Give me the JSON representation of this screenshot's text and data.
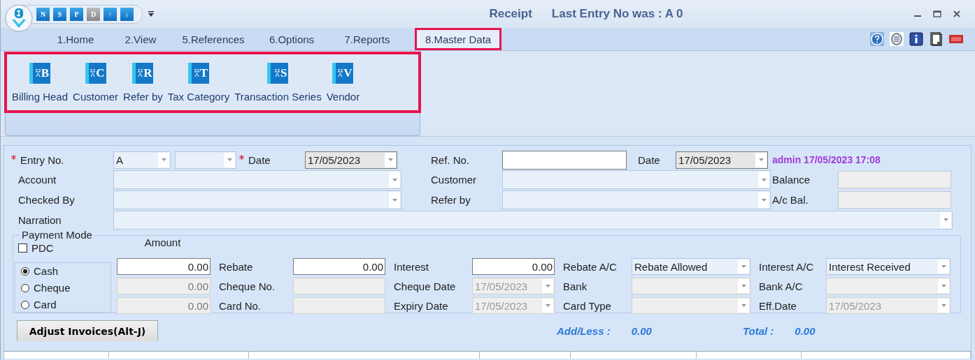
{
  "window": {
    "title": "Receipt",
    "subtitle": "Last Entry No was : A 0"
  },
  "quick_access": [
    {
      "glyph": "N",
      "disabled": false
    },
    {
      "glyph": "S",
      "disabled": false
    },
    {
      "glyph": "P",
      "disabled": false
    },
    {
      "glyph": "D",
      "disabled": true
    },
    {
      "glyph": "↑",
      "disabled": false
    },
    {
      "glyph": "↓",
      "disabled": false
    }
  ],
  "tabs": [
    {
      "label": "1.Home",
      "selected": false
    },
    {
      "label": "2.View",
      "selected": false
    },
    {
      "label": "5.References",
      "selected": false
    },
    {
      "label": "6.Options",
      "selected": false
    },
    {
      "label": "7.Reports",
      "selected": false
    },
    {
      "label": "8.Master Data",
      "selected": true
    }
  ],
  "ribbon": {
    "highlighted": true,
    "buttons": [
      {
        "label": "Billing Head",
        "letter": "B"
      },
      {
        "label": "Customer",
        "letter": "C"
      },
      {
        "label": "Refer by",
        "letter": "R"
      },
      {
        "label": "Tax Category",
        "letter": "T"
      },
      {
        "label": "Transaction Series",
        "letter": "S"
      },
      {
        "label": "Vendor",
        "letter": "V"
      }
    ]
  },
  "form": {
    "entry_no": {
      "label": "Entry No.",
      "required": true,
      "series": "A"
    },
    "date": {
      "label": "Date",
      "required": true,
      "value": "17/05/2023"
    },
    "ref_no": {
      "label": "Ref. No."
    },
    "ref_date": {
      "label": "Date",
      "value": "17/05/2023"
    },
    "created": "admin 17/05/2023 17:08",
    "account": {
      "label": "Account"
    },
    "customer": {
      "label": "Customer"
    },
    "balance": {
      "label": "Balance"
    },
    "checked_by": {
      "label": "Checked By"
    },
    "refer_by": {
      "label": "Refer by"
    },
    "ac_bal": {
      "label": "A/c Bal."
    },
    "narration": {
      "label": "Narration"
    }
  },
  "payment": {
    "title": "Payment Mode",
    "amount_label": "Amount",
    "pdc": {
      "label": "PDC",
      "checked": false
    },
    "rows": [
      {
        "mode": "Cash",
        "selected": true,
        "amount": "0.00",
        "disabled": false,
        "fields": [
          {
            "label": "Rebate",
            "kind": "text",
            "value": "0.00",
            "disabled": false
          },
          {
            "label": "Interest",
            "kind": "text",
            "value": "0.00",
            "disabled": false
          },
          {
            "label": "Rebate A/C",
            "kind": "combo",
            "value": "Rebate Allowed",
            "disabled": false
          },
          {
            "label": "Interest A/C",
            "kind": "combo",
            "value": "Interest Received",
            "disabled": false
          }
        ]
      },
      {
        "mode": "Cheque",
        "selected": false,
        "amount": "0.00",
        "disabled": true,
        "fields": [
          {
            "label": "Cheque No.",
            "kind": "text",
            "disabled": true
          },
          {
            "label": "Cheque Date",
            "kind": "combo",
            "value": "17/05/2023",
            "disabled": true
          },
          {
            "label": "Bank",
            "kind": "combo",
            "disabled": true
          },
          {
            "label": "Bank A/C",
            "kind": "combo",
            "disabled": true
          }
        ]
      },
      {
        "mode": "Card",
        "selected": false,
        "amount": "0.00",
        "disabled": true,
        "fields": [
          {
            "label": "Card No.",
            "kind": "text",
            "disabled": true
          },
          {
            "label": "Expiry Date",
            "kind": "combo",
            "value": "17/05/2023",
            "disabled": true
          },
          {
            "label": "Card Type",
            "kind": "combo",
            "disabled": true
          },
          {
            "label": "Eff.Date",
            "kind": "combo",
            "value": "17/05/2023",
            "disabled": true
          }
        ]
      }
    ]
  },
  "adjust_button": "Adjust Invoices(Alt-J)",
  "totals": [
    {
      "label": "Add/Less :",
      "value": "0.00"
    },
    {
      "label": "Total :",
      "value": "0.00"
    }
  ]
}
